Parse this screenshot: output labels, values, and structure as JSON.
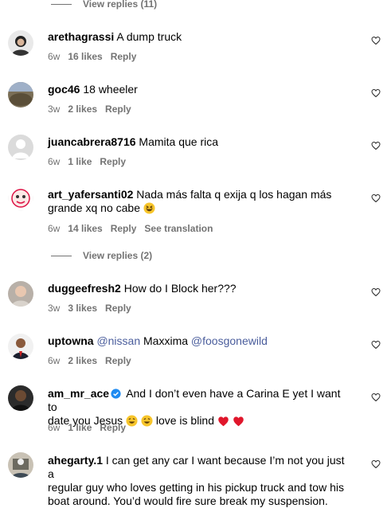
{
  "thread_top": {
    "view_replies": "View replies (11)"
  },
  "comments": [
    {
      "username": "arethagrassi",
      "text": "A dump truck",
      "time": "6w",
      "likes": "16 likes",
      "reply": "Reply"
    },
    {
      "username": "goc46",
      "text": "18 wheeler",
      "time": "3w",
      "likes": "2 likes",
      "reply": "Reply"
    },
    {
      "username": "juancabrera8716",
      "text": "Mamita que rica",
      "time": "6w",
      "likes": "1 like",
      "reply": "Reply"
    },
    {
      "username": "art_yafersanti02",
      "text_line1": "Nada más falta q exija q los hagan más",
      "text_line2": "grande xq no cabe",
      "time": "6w",
      "likes": "14 likes",
      "reply": "Reply",
      "translation": "See translation",
      "emoji_icon": "grinning-squinting-face-icon"
    },
    {
      "username": "duggeefresh2",
      "text": "How do I Block her???",
      "time": "3w",
      "likes": "3 likes",
      "reply": "Reply"
    },
    {
      "username": "uptowna",
      "mention1": "@nissan",
      "text_mid": "Maxxima",
      "mention2": "@foosgonewild",
      "time": "6w",
      "likes": "2 likes",
      "reply": "Reply"
    },
    {
      "username": "am_mr_ace",
      "text_line1": "And I don’t even have a Carina E yet I want to",
      "text_line2a": "date you Jesus",
      "text_line2b": "love is blind",
      "time": "6w",
      "likes": "1 like",
      "reply": "Reply",
      "verified": true
    },
    {
      "username": "ahegarty.1",
      "text_line1": "I can get any car I want because I’m not you just a",
      "text_line2": "regular guy who loves getting in his pickup truck and tow his",
      "text_line3": "boat around. You’d would fire sure break my suspension."
    }
  ],
  "mid_thread": {
    "view_replies": "View replies (2)"
  },
  "colors": {
    "meta_gray": "#737373",
    "mention_blue": "#4a5d9c",
    "verified_blue": "#1f8bf1",
    "heart_red": "#e0162b"
  }
}
